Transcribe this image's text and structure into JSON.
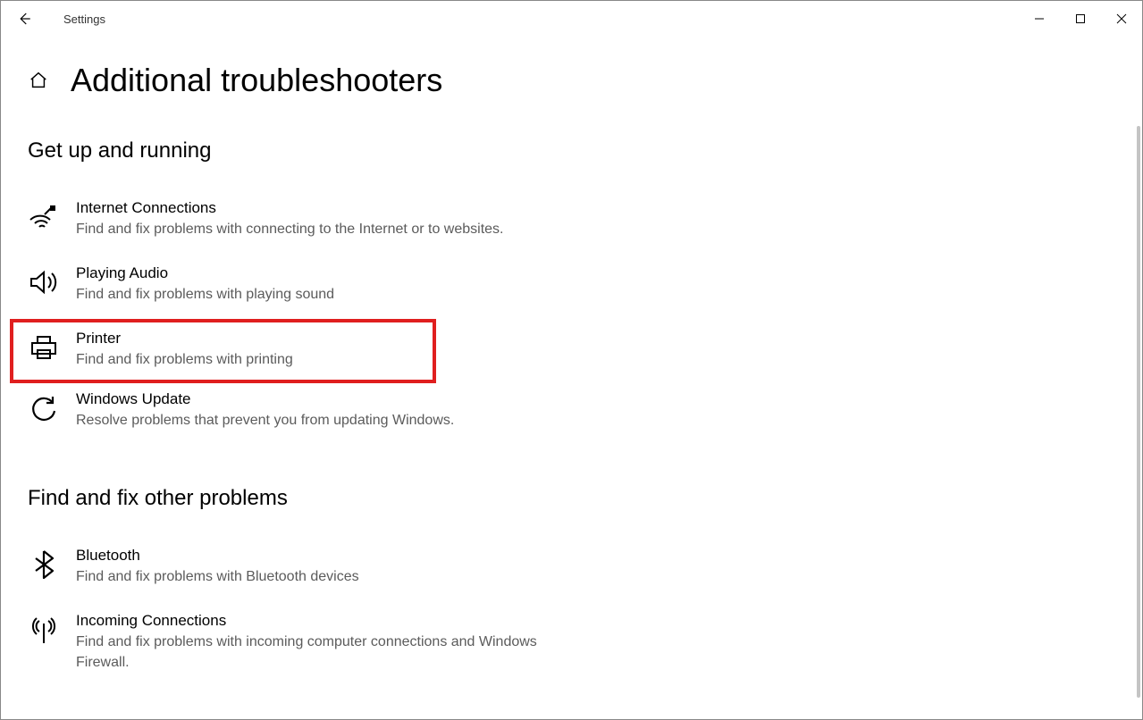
{
  "window": {
    "app_title": "Settings"
  },
  "page": {
    "title": "Additional troubleshooters"
  },
  "sections": {
    "get_up": {
      "title": "Get up and running",
      "items": [
        {
          "title": "Internet Connections",
          "desc": "Find and fix problems with connecting to the Internet or to websites."
        },
        {
          "title": "Playing Audio",
          "desc": "Find and fix problems with playing sound"
        },
        {
          "title": "Printer",
          "desc": "Find and fix problems with printing"
        },
        {
          "title": "Windows Update",
          "desc": "Resolve problems that prevent you from updating Windows."
        }
      ]
    },
    "other": {
      "title": "Find and fix other problems",
      "items": [
        {
          "title": "Bluetooth",
          "desc": "Find and fix problems with Bluetooth devices"
        },
        {
          "title": "Incoming Connections",
          "desc": "Find and fix problems with incoming computer connections and Windows Firewall."
        }
      ]
    }
  }
}
